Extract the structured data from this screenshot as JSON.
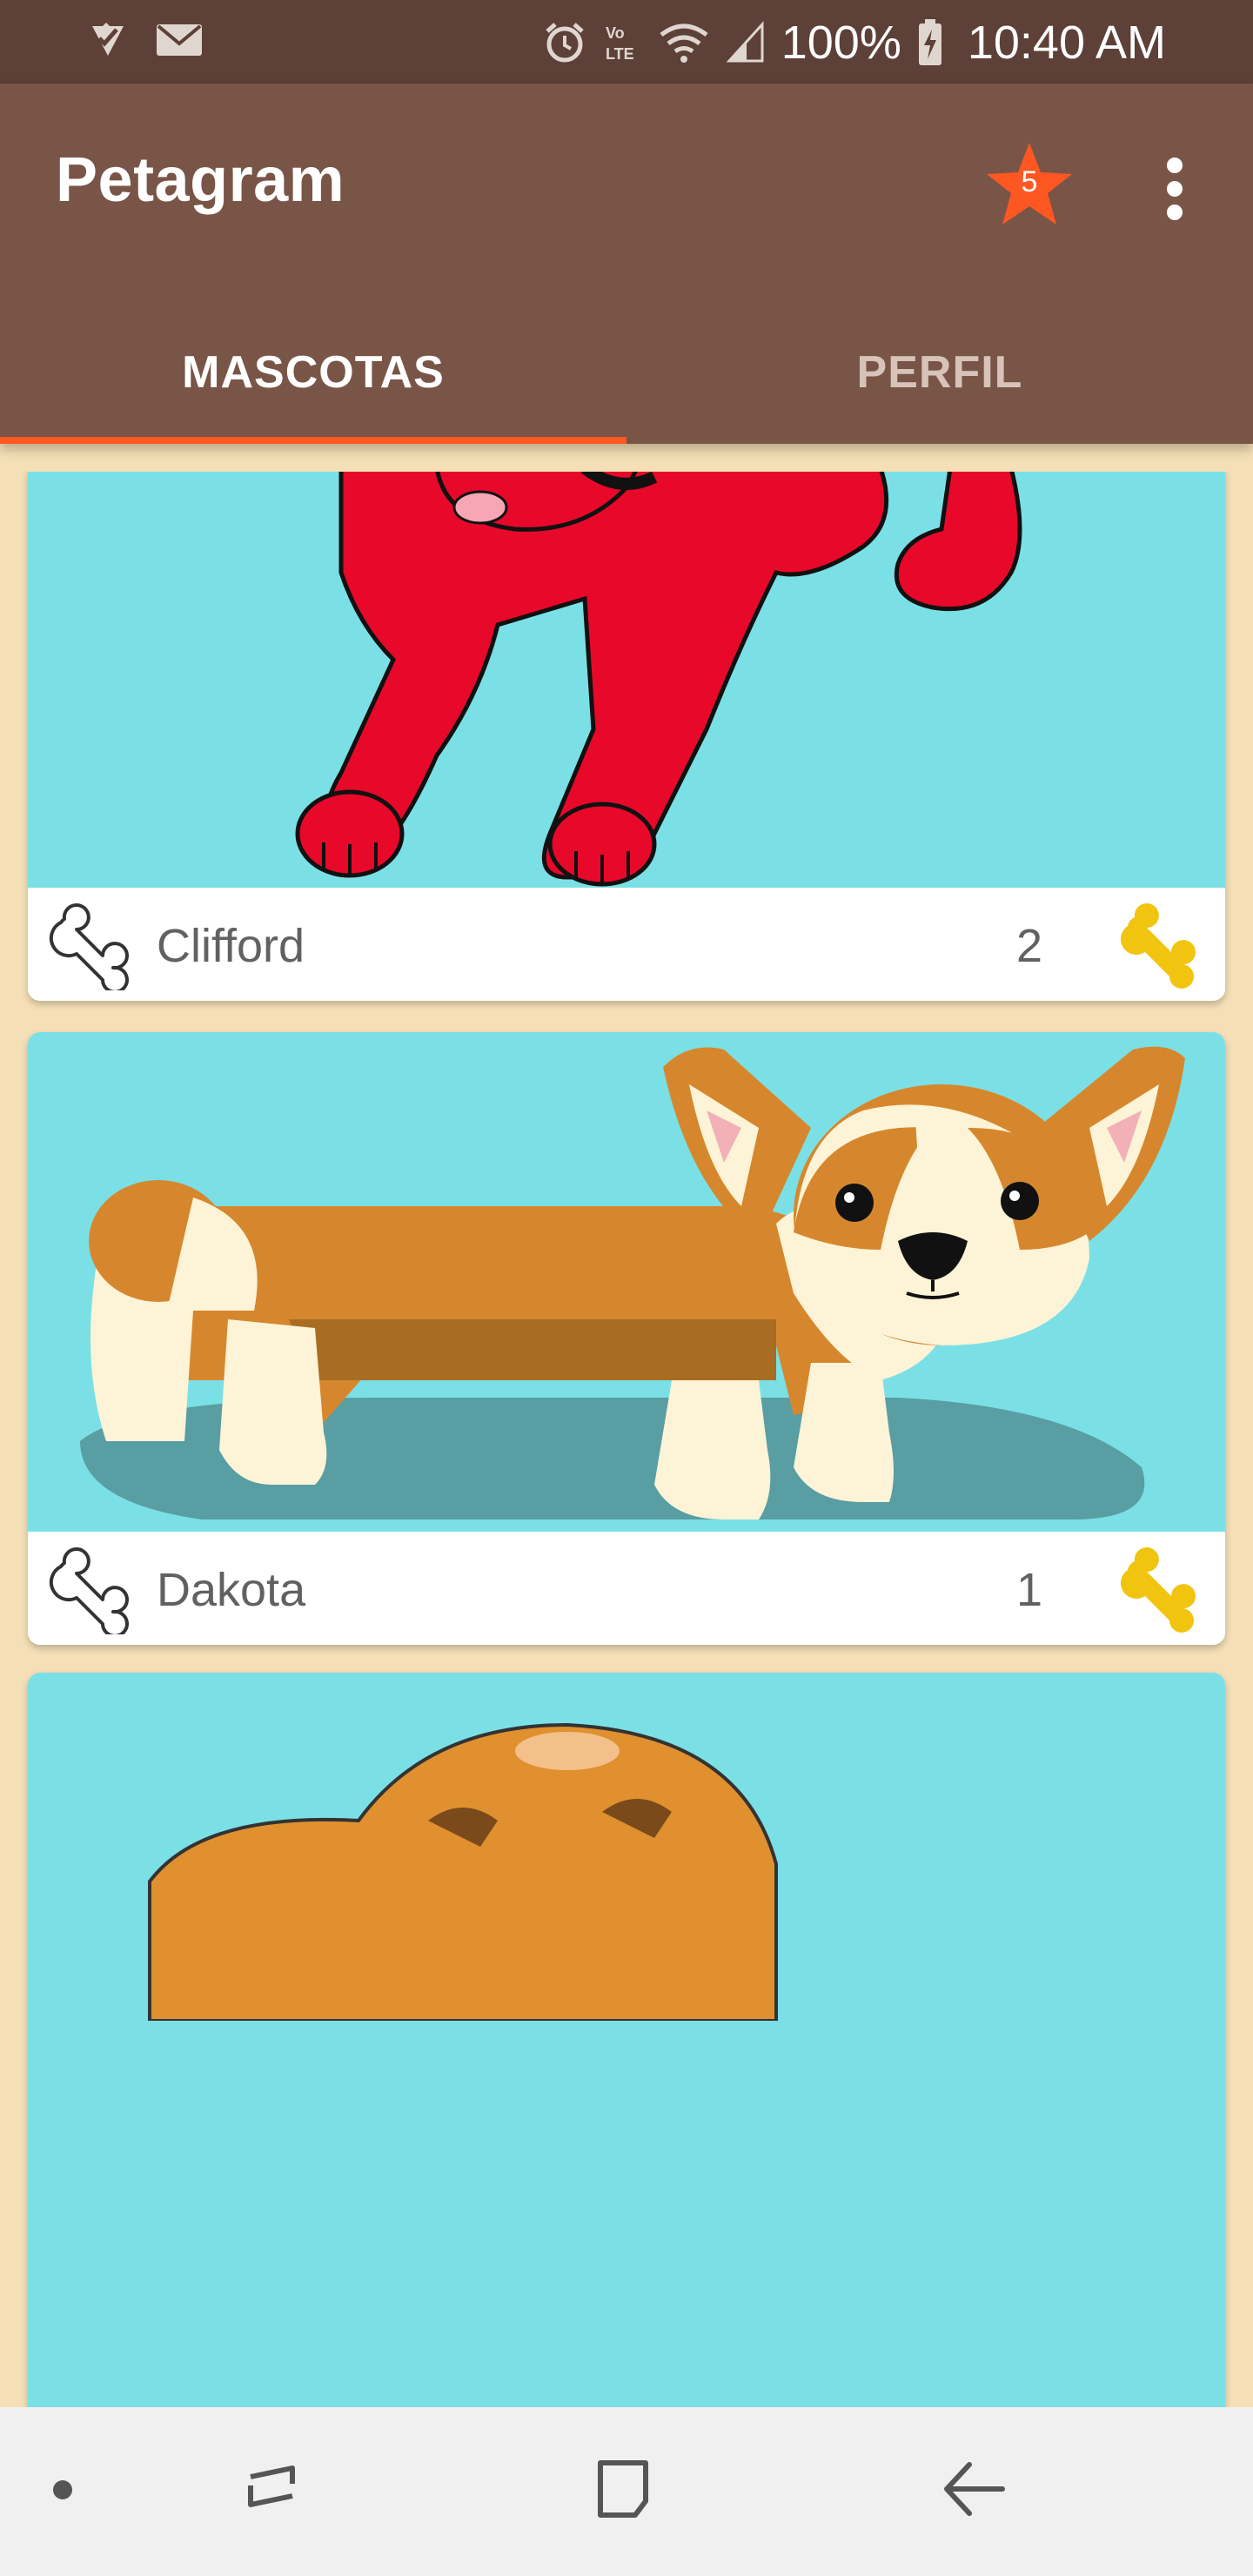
{
  "status_bar": {
    "battery": "100%",
    "time": "10:40 AM",
    "icons": [
      "checklist-icon",
      "mail-icon",
      "alarm-icon",
      "volte-icon",
      "wifi-icon",
      "signal-icon",
      "battery-charging-icon"
    ]
  },
  "app_bar": {
    "title": "Petagram",
    "favorites_count": "5",
    "icons": [
      "star-icon",
      "more-vert-icon"
    ]
  },
  "tabs": [
    {
      "label": "MASCOTAS",
      "active": true
    },
    {
      "label": "PERFIL",
      "active": false
    }
  ],
  "pets": [
    {
      "name": "Clifford",
      "likes": "2"
    },
    {
      "name": "Dakota",
      "likes": "1"
    }
  ],
  "nav_bar": {
    "icons": [
      "dot-icon",
      "recent-apps-icon",
      "home-icon",
      "back-icon"
    ]
  },
  "colors": {
    "status_bar": "#5d4037",
    "app_bar": "#795548",
    "accent": "#ff5722",
    "background": "#f4dfb6",
    "photo_bg": "#7ae0e6",
    "bone_yellow": "#f1c40f"
  }
}
